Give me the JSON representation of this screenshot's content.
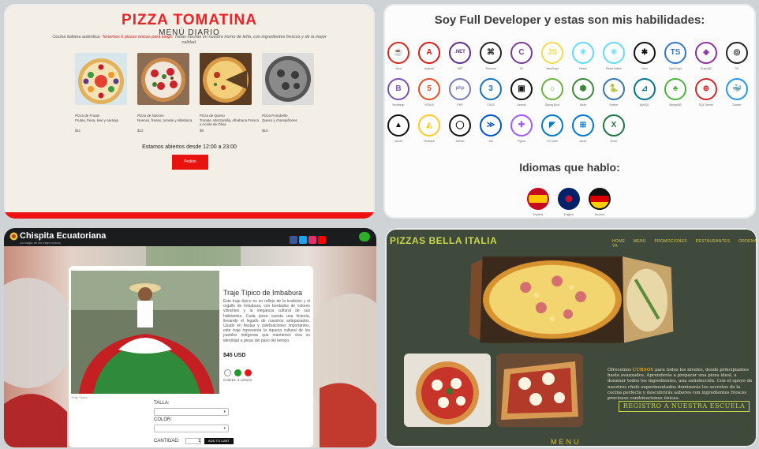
{
  "tomatina": {
    "title": "PIZZA TOMATINA",
    "subtitle": "MENÚ DIARIO",
    "description_lead": "Cocina italiana auténtica.",
    "description_highlight": "Tenemos 6 pizzas únicas para elegir.",
    "description_tail": "Todas hechas en nuestro horno de leña, con ingredientes frescos y de la mejor calidad.",
    "pizzas": [
      {
        "name": "Pizza de Frutas",
        "detail": "Frutas, fresa, kiwi y naranja",
        "price": "$11"
      },
      {
        "name": "Pizza de Nueces",
        "detail": "Nueces, fresas, tomate y albahaca",
        "price": "$12"
      },
      {
        "name": "Pizza de Queso",
        "detail": "Tomate, Mozzarella, Albahaca Fresca y Aceite de Oliva",
        "price": "$9"
      },
      {
        "name": "Pizza Portobello",
        "detail": "Queso y champiñones",
        "price": "$10"
      }
    ],
    "hours": "Estamos abiertos desde 12:00 a 23:00",
    "button": "Pedido"
  },
  "skills": {
    "heading": "Soy Full Developer y estas son mis habilidades:",
    "languages_heading": "Idiomas que hablo:",
    "items": [
      {
        "glyph": "☕",
        "label": "Java",
        "color": "#d52b1e"
      },
      {
        "glyph": "A",
        "label": "Angular",
        "color": "#dd1b16"
      },
      {
        "glyph": ".NET",
        "label": ".NET",
        "color": "#5c2d91"
      },
      {
        "glyph": "⌘",
        "label": "Terminal",
        "color": "#222222"
      },
      {
        "glyph": "C",
        "label": "C#",
        "color": "#7c3b9c"
      },
      {
        "glyph": "JS",
        "label": "JavaScript",
        "color": "#f0db4f"
      },
      {
        "glyph": "⚛",
        "label": "React",
        "color": "#61dafb"
      },
      {
        "glyph": "⚛",
        "label": "React Native",
        "color": "#61dafb"
      },
      {
        "glyph": "✱",
        "label": "Next",
        "color": "#111111"
      },
      {
        "glyph": "TS",
        "label": "TypeScript",
        "color": "#3178c6"
      },
      {
        "glyph": "◈",
        "label": "GraphQL",
        "color": "#8a2fa0"
      },
      {
        "glyph": "◎",
        "label": "Git",
        "color": "#222222"
      },
      {
        "glyph": "B",
        "label": "Bootstrap",
        "color": "#7952b3"
      },
      {
        "glyph": "5",
        "label": "HTML5",
        "color": "#e34f26"
      },
      {
        "glyph": "php",
        "label": "PHP",
        "color": "#777bb4"
      },
      {
        "glyph": "3",
        "label": "CSS3",
        "color": "#1572b6"
      },
      {
        "glyph": "▣",
        "label": "Laravel",
        "color": "#111111"
      },
      {
        "glyph": "☼",
        "label": "Spring Boot",
        "color": "#6db33f"
      },
      {
        "glyph": "⬢",
        "label": "Node",
        "color": "#3c873a"
      },
      {
        "glyph": "🐍",
        "label": "Python",
        "color": "#3776ab"
      },
      {
        "glyph": "⊿",
        "label": "MySQL",
        "color": "#00758f"
      },
      {
        "glyph": "♣",
        "label": "MongoDB",
        "color": "#4db33d"
      },
      {
        "glyph": "⊕",
        "label": "SQL Server",
        "color": "#cc2927"
      },
      {
        "glyph": "🐳",
        "label": "Docker",
        "color": "#2496ed"
      },
      {
        "glyph": "▲",
        "label": "Vercel",
        "color": "#111111"
      },
      {
        "glyph": "◭",
        "label": "Firebase",
        "color": "#ffca28"
      },
      {
        "glyph": "◯",
        "label": "GitHub",
        "color": "#111111"
      },
      {
        "glyph": "≫",
        "label": "Jira",
        "color": "#0052cc"
      },
      {
        "glyph": "✚",
        "label": "Figma",
        "color": "#a259ff"
      },
      {
        "glyph": "◤",
        "label": "VS Code",
        "color": "#007acc"
      },
      {
        "glyph": "⊞",
        "label": "Azure",
        "color": "#0078d4"
      },
      {
        "glyph": "X",
        "label": "Excel",
        "color": "#217346"
      }
    ],
    "languages": [
      {
        "label": "Español",
        "color": "#c60b1e"
      },
      {
        "label": "English",
        "color": "#012169"
      },
      {
        "label": "Deutsch",
        "color": "#111111"
      }
    ]
  },
  "chispita": {
    "brand": "Chispita Ecuatoriana",
    "tagline": "La magia de los trajes típicos",
    "product_title": "Traje Típico de Imbabura",
    "product_desc": "Este traje típico es un reflejo de la tradición y el orgullo de Imbabura, con bordados de colores vibrantes y la elegancia cultural de sus habitantes. Cada pieza cuenta una historia, llevando el legado de nuestros antepasados. Usado en fiestas y celebraciones importantes, este traje representa la riqueza cultural de los pueblos indígenas que mantienen viva su identidad a pesar del paso del tiempo.",
    "price": "$45 USD",
    "colors_label": "Colores: 3 colores",
    "caption": "Traje Típico",
    "size_label": "TALLA:",
    "color_label": "COLOR:",
    "qty_label": "CANTIDAD:",
    "qty_value": "1",
    "cart_button": "ADD TO CART",
    "select_caret": "▾"
  },
  "bella": {
    "brand": "PIZZAS BELLA ITALIA",
    "menu": [
      "HOME",
      "MENÚ",
      "PROMOCIONES",
      "RESTAURANTES",
      "ORDENA YA"
    ],
    "text_lead": "Ofrecemos",
    "text_highlight": "CURSOS",
    "text_tail": "para todos los niveles, desde principiantes hasta avanzados. Aprenderás a preparar una pizza ideal, a dominar todos los ingredientes, una satisfacción. Con el apoyo de nuestros chefs experimentados dominarás los secretos de la cocina perfecta y descubrirás sabores con ingredientes frescos preciosos combinaciones únicas.",
    "register": "REGISTRO A NUESTRA ESCUELA",
    "menu_heading": "MENU"
  },
  "colors": {
    "tomatina_red": "#e8262a",
    "bella_lime": "#c7d64a",
    "bella_gold": "#d6c244"
  }
}
